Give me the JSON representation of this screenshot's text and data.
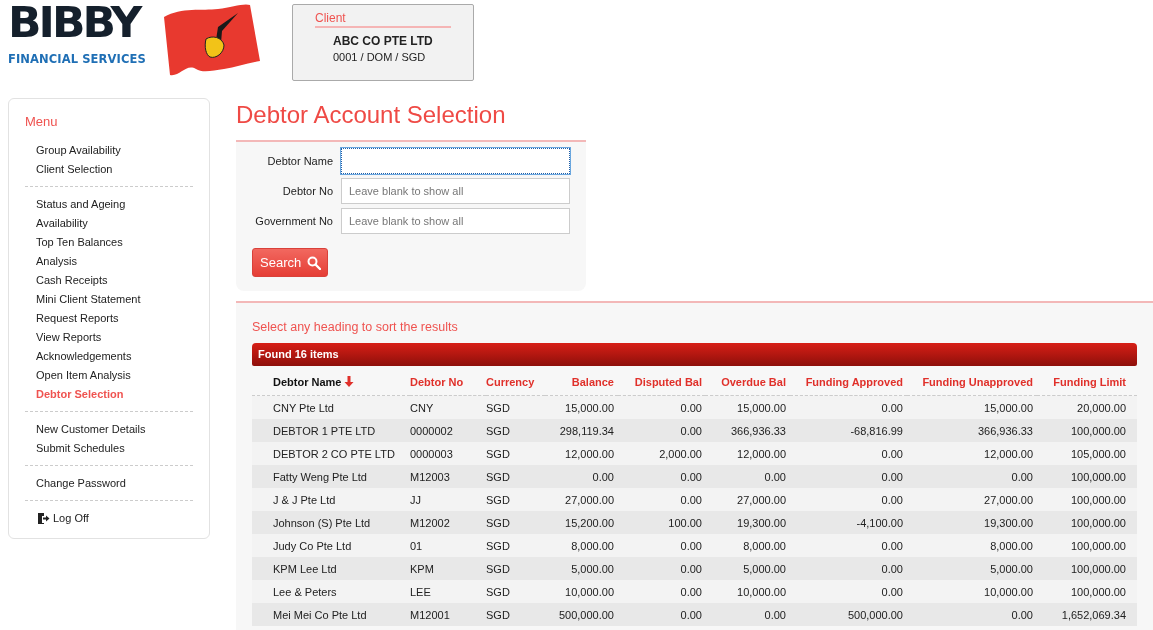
{
  "logo": {
    "name": "BIBBY",
    "tagline": "FINANCIAL SERVICES"
  },
  "client": {
    "label": "Client",
    "name": "ABC CO PTE LTD",
    "code": "0001 / DOM / SGD"
  },
  "menu": {
    "title": "Menu",
    "groups": [
      {
        "items": [
          {
            "label": "Group Availability",
            "selected": false
          },
          {
            "label": "Client Selection",
            "selected": false
          }
        ]
      },
      {
        "items": [
          {
            "label": "Status and Ageing",
            "selected": false
          },
          {
            "label": "Availability",
            "selected": false
          },
          {
            "label": "Top Ten Balances",
            "selected": false
          },
          {
            "label": "Analysis",
            "selected": false
          },
          {
            "label": "Cash Receipts",
            "selected": false
          },
          {
            "label": "Mini Client Statement",
            "selected": false
          },
          {
            "label": "Request Reports",
            "selected": false
          },
          {
            "label": "View Reports",
            "selected": false
          },
          {
            "label": "Acknowledgements",
            "selected": false
          },
          {
            "label": "Open Item Analysis",
            "selected": false
          },
          {
            "label": "Debtor Selection",
            "selected": true
          }
        ]
      },
      {
        "items": [
          {
            "label": "New Customer Details",
            "selected": false
          },
          {
            "label": "Submit Schedules",
            "selected": false
          }
        ]
      },
      {
        "items": [
          {
            "label": "Change Password",
            "selected": false
          }
        ]
      }
    ],
    "logoff": "Log Off"
  },
  "page_title": "Debtor Account Selection",
  "form": {
    "fields": [
      {
        "label": "Debtor Name",
        "focused": true
      },
      {
        "label": "Debtor No",
        "placeholder": "Leave blank to show all",
        "focused": false
      },
      {
        "label": "Government No",
        "placeholder": "Leave blank to show all",
        "focused": false
      }
    ],
    "button": "Search"
  },
  "results": {
    "hint": "Select any heading to sort the results",
    "summary": "Found 16 items",
    "columns": [
      {
        "label": "Debtor Name",
        "kind": "text",
        "sorted": true
      },
      {
        "label": "Debtor No",
        "kind": "text",
        "sorted": false
      },
      {
        "label": "Currency",
        "kind": "text",
        "sorted": false
      },
      {
        "label": "Balance",
        "kind": "number",
        "sorted": false
      },
      {
        "label": "Disputed Bal",
        "kind": "number",
        "sorted": false
      },
      {
        "label": "Overdue Bal",
        "kind": "number",
        "sorted": false
      },
      {
        "label": "Funding Approved",
        "kind": "number",
        "sorted": false
      },
      {
        "label": "Funding Unapproved",
        "kind": "number",
        "sorted": false
      },
      {
        "label": "Funding Limit",
        "kind": "number",
        "sorted": false
      }
    ],
    "rows": [
      [
        "CNY Pte Ltd",
        "CNY",
        "SGD",
        "15,000.00",
        "0.00",
        "15,000.00",
        "0.00",
        "15,000.00",
        "20,000.00"
      ],
      [
        "DEBTOR 1 PTE LTD",
        "0000002",
        "SGD",
        "298,119.34",
        "0.00",
        "366,936.33",
        "-68,816.99",
        "366,936.33",
        "100,000.00"
      ],
      [
        "DEBTOR 2 CO PTE LTD",
        "0000003",
        "SGD",
        "12,000.00",
        "2,000.00",
        "12,000.00",
        "0.00",
        "12,000.00",
        "105,000.00"
      ],
      [
        "Fatty Weng Pte Ltd",
        "M12003",
        "SGD",
        "0.00",
        "0.00",
        "0.00",
        "0.00",
        "0.00",
        "100,000.00"
      ],
      [
        "J & J Pte Ltd",
        "JJ",
        "SGD",
        "27,000.00",
        "0.00",
        "27,000.00",
        "0.00",
        "27,000.00",
        "100,000.00"
      ],
      [
        "Johnson (S) Pte Ltd",
        "M12002",
        "SGD",
        "15,200.00",
        "100.00",
        "19,300.00",
        "-4,100.00",
        "19,300.00",
        "100,000.00"
      ],
      [
        "Judy Co Pte Ltd",
        "01",
        "SGD",
        "8,000.00",
        "0.00",
        "8,000.00",
        "0.00",
        "8,000.00",
        "100,000.00"
      ],
      [
        "KPM Lee Ltd",
        "KPM",
        "SGD",
        "5,000.00",
        "0.00",
        "5,000.00",
        "0.00",
        "5,000.00",
        "100,000.00"
      ],
      [
        "Lee & Peters",
        "LEE",
        "SGD",
        "10,000.00",
        "0.00",
        "10,000.00",
        "0.00",
        "10,000.00",
        "100,000.00"
      ],
      [
        "Mei Mei Co Pte Ltd",
        "M12001",
        "SGD",
        "500,000.00",
        "0.00",
        "0.00",
        "500,000.00",
        "0.00",
        "1,652,069.34"
      ]
    ]
  }
}
